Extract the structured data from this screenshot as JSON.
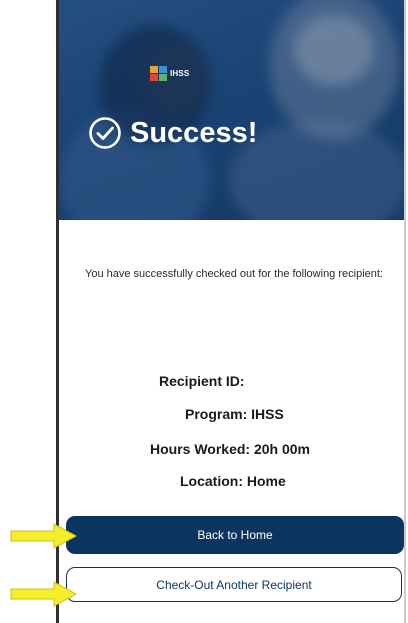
{
  "header": {
    "logo_text": "IHSS",
    "logo_colors": [
      "#e8a33a",
      "#3d8fd1",
      "#e0473c",
      "#5bb36a"
    ],
    "success_icon": "check-circle-icon",
    "title": "Success!"
  },
  "message": {
    "text": "You have successfully checked out for the following recipient:"
  },
  "details": {
    "recipient_id": "Recipient ID:",
    "program": "Program: IHSS",
    "hours_worked": "Hours Worked: 20h 00m",
    "location": "Location: Home"
  },
  "actions": {
    "back_home_label": "Back to Home",
    "check_out_another_label": "Check-Out Another Recipient"
  },
  "annotations": {
    "arrow_icon": "right-arrow-icon",
    "arrow_color": "#f5ef2a"
  },
  "colors": {
    "primary": "#0b3560",
    "hero": "#1f4a7c"
  }
}
